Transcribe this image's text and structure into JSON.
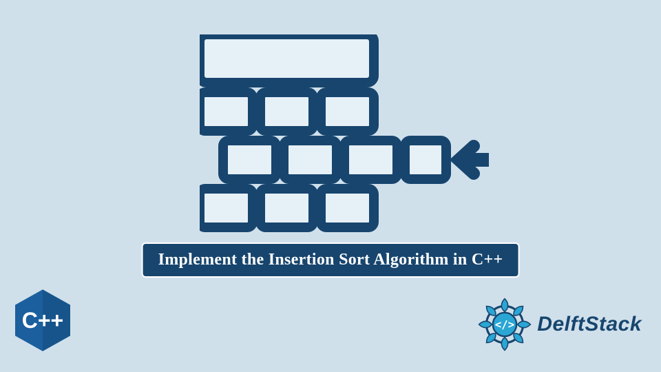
{
  "colors": {
    "bg": "#d0e0eb",
    "primary": "#17456e",
    "cell_fill": "#e6f0f7",
    "white": "#ffffff",
    "cpp_badge": "#1b5f9e"
  },
  "title": "Implement the Insertion Sort Algorithm in C++",
  "cpp_badge_label": "C++",
  "brand": {
    "name": "DelftStack",
    "logo_glyph": "</>"
  },
  "illustration": {
    "type": "table-insert-icon",
    "description": "Stylized table grid with an extra row being inserted from the right, indicated by a left-pointing arrow"
  }
}
